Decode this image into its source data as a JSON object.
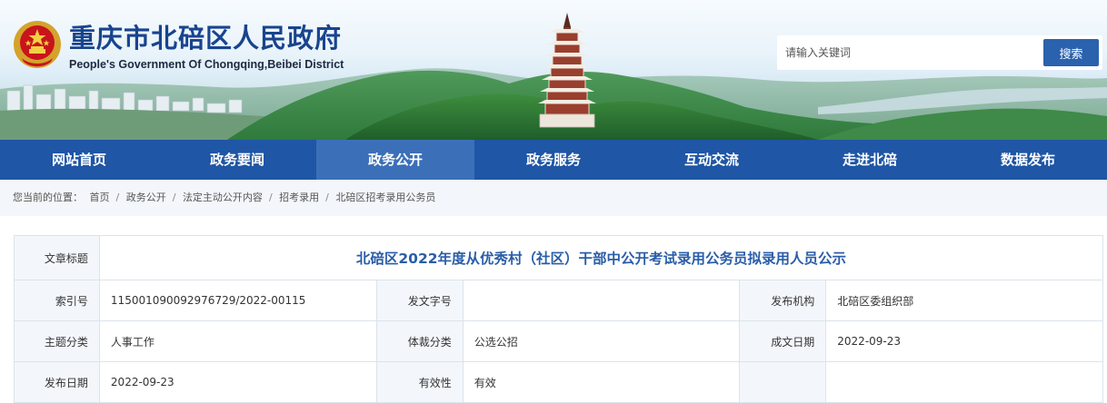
{
  "site": {
    "title": "重庆市北碚区人民政府",
    "subtitle": "People's Government Of Chongqing,Beibei District"
  },
  "search": {
    "placeholder": "请输入关键词",
    "button_label": "搜索"
  },
  "nav": {
    "items": [
      {
        "label": "网站首页"
      },
      {
        "label": "政务要闻"
      },
      {
        "label": "政务公开"
      },
      {
        "label": "政务服务"
      },
      {
        "label": "互动交流"
      },
      {
        "label": "走进北碚"
      },
      {
        "label": "数据发布"
      }
    ],
    "active_index": 2
  },
  "breadcrumb": {
    "prefix": "您当前的位置：",
    "items": [
      "首页",
      "政务公开",
      "法定主动公开内容",
      "招考录用",
      "北碚区招考录用公务员"
    ]
  },
  "article": {
    "title_label": "文章标题",
    "title": "北碚区2022年度从优秀村（社区）干部中公开考试录用公务员拟录用人员公示",
    "rows": [
      [
        {
          "label": "索引号",
          "value": "115001090092976729/2022-00115"
        },
        {
          "label": "发文字号",
          "value": ""
        },
        {
          "label": "发布机构",
          "value": "北碚区委组织部"
        }
      ],
      [
        {
          "label": "主题分类",
          "value": "人事工作"
        },
        {
          "label": "体裁分类",
          "value": "公选公招"
        },
        {
          "label": "成文日期",
          "value": "2022-09-23"
        }
      ],
      [
        {
          "label": "发布日期",
          "value": "2022-09-23"
        },
        {
          "label": "有效性",
          "value": "有效"
        },
        {
          "label": "",
          "value": ""
        }
      ]
    ]
  },
  "colors": {
    "brand_blue": "#1f56a5",
    "nav_active": "#3b70b8",
    "title_blue": "#2a5da8"
  },
  "icons": [
    "national-emblem-icon",
    "pagoda-illustration"
  ]
}
